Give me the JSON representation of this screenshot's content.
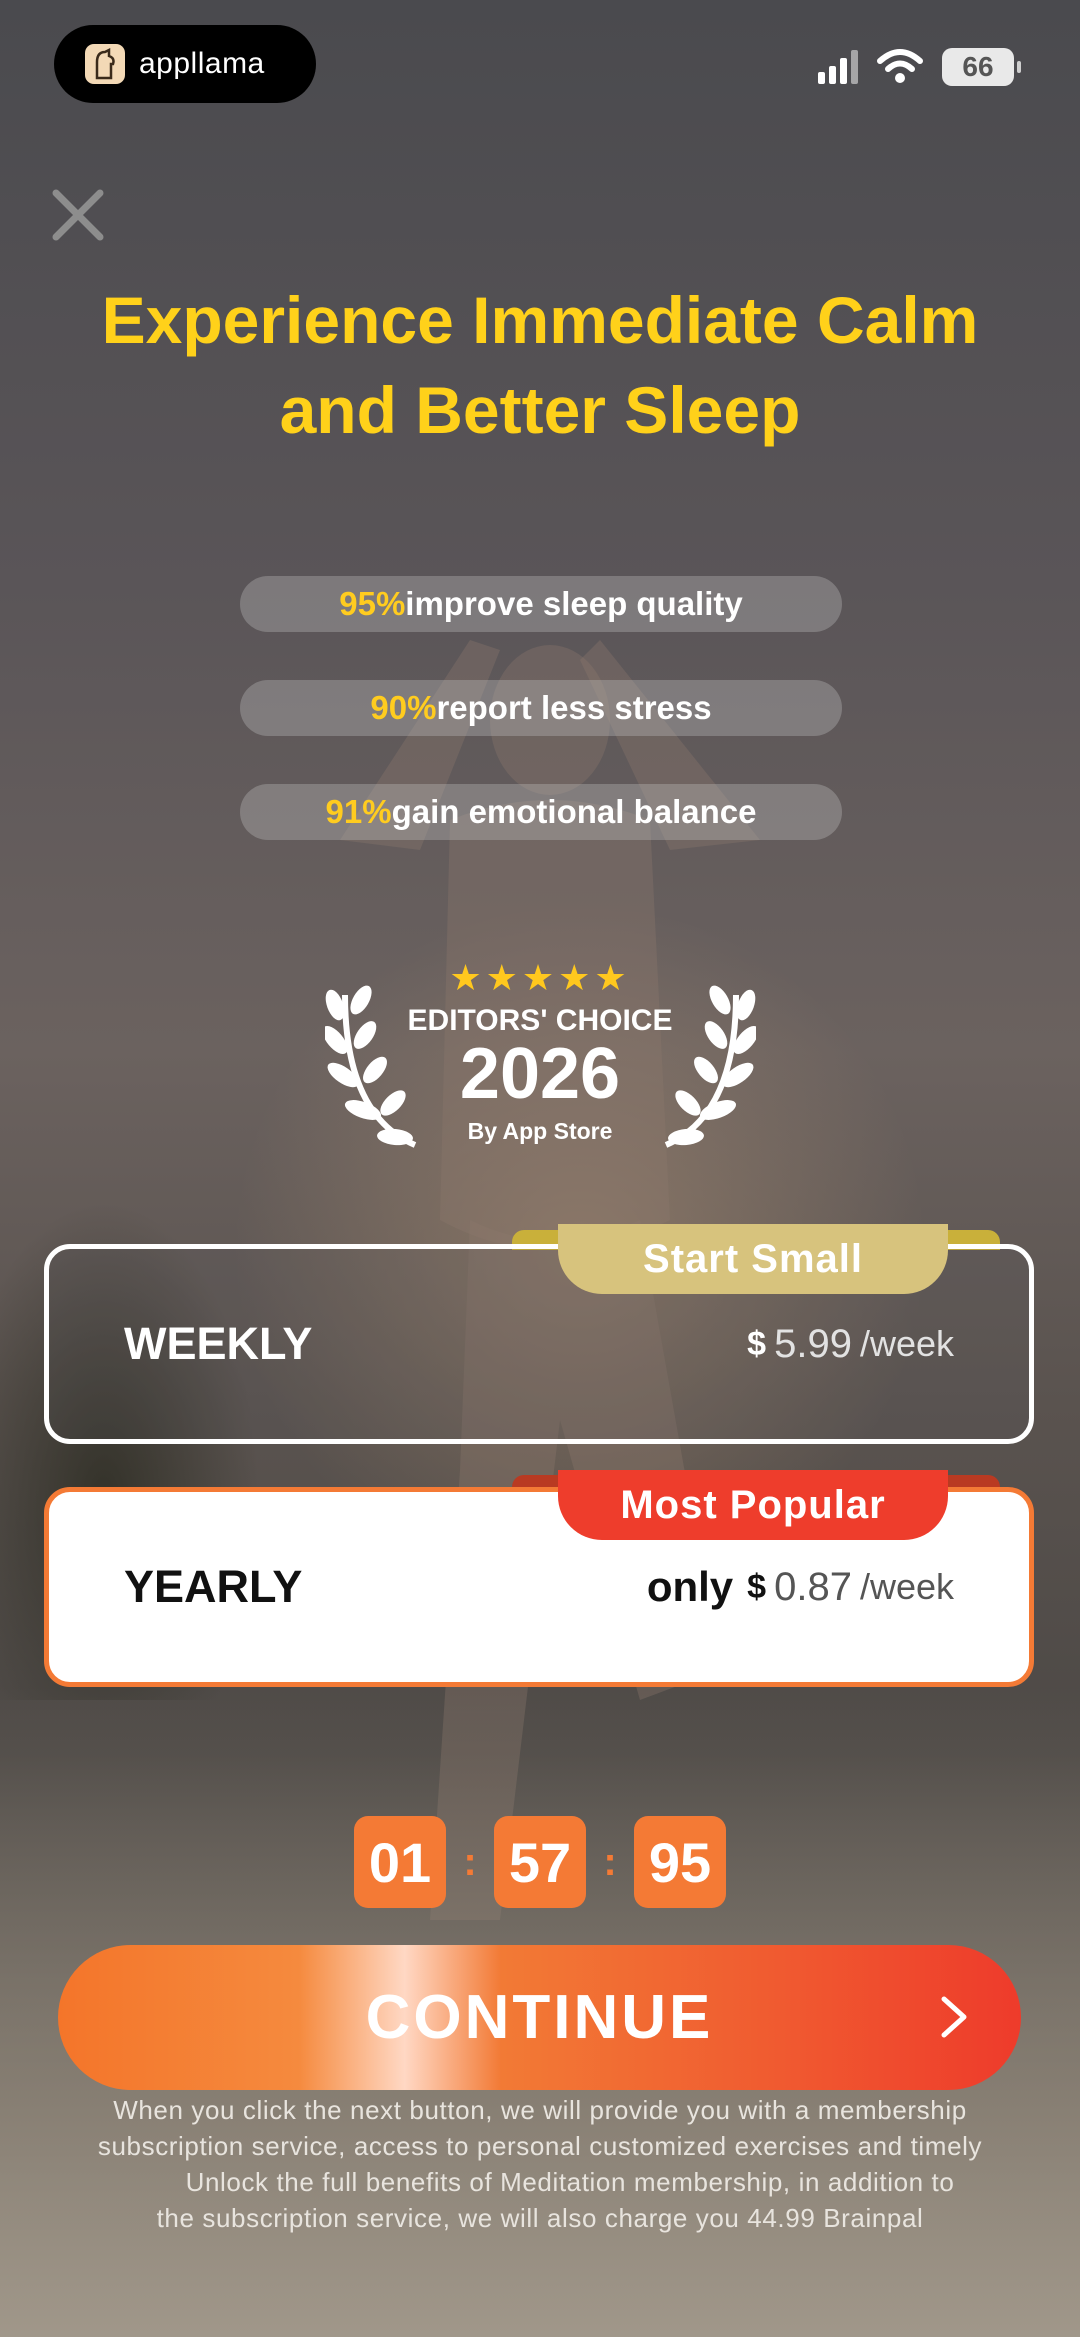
{
  "app_pill": {
    "name": "appllama"
  },
  "status_bar": {
    "battery": "66"
  },
  "headline": {
    "line1": "Experience Immediate Calm",
    "line2": "and Better Sleep"
  },
  "stats": [
    {
      "pct": "95%",
      "text": " improve sleep quality"
    },
    {
      "pct": "90%",
      "text": "report less stress"
    },
    {
      "pct": "91%",
      "text": "gain emotional balance"
    }
  ],
  "award": {
    "stars": "★★★★★",
    "title": "EDITORS' CHOICE",
    "year": "2026",
    "by": "By App Store"
  },
  "plans": {
    "weekly": {
      "tag": "Start Small",
      "name": "WEEKLY",
      "currency": "$",
      "amount": "5.99",
      "unit": "/week"
    },
    "yearly": {
      "tag": "Most Popular",
      "name": "YEARLY",
      "prefix": "only",
      "currency": "$",
      "amount": "0.87",
      "unit": "/week"
    }
  },
  "timer": {
    "h": "01",
    "m": "57",
    "s": "95",
    "sep": ":"
  },
  "cta": {
    "label": "CONTINUE"
  },
  "legal": {
    "line1": "When you click the next button, we will provide you with a membership",
    "line2": "subscription service, access to personal customized exercises and timely",
    "line3": "Unlock the full benefits of Meditation membership, in addition to",
    "line4": "the subscription service, we will also charge you 44.99 Brainpal"
  },
  "colors": {
    "accent_yellow": "#ffd11a",
    "accent_orange": "#f47a35",
    "accent_red": "#ee3b2b",
    "tag_gold": "#d7c37d"
  }
}
